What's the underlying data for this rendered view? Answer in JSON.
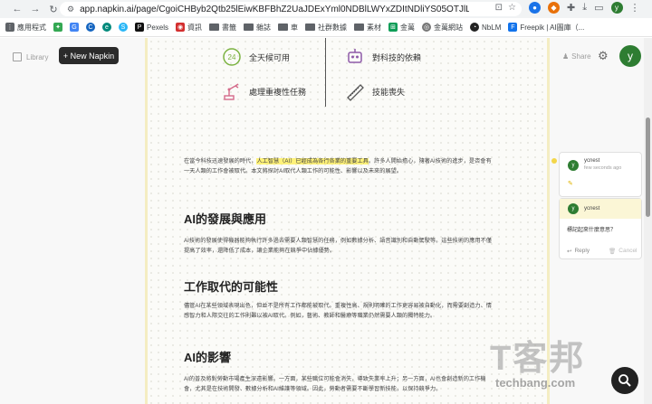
{
  "browser": {
    "url": "app.napkin.ai/page/CgoiCHByb2Qtb25lEiwKBFBhZ2UaJDExYml0NDBlLWYxZDItNDliYS05OTJlLTE0NzcxYzViM..."
  },
  "bookmarks": [
    {
      "label": "應用程式",
      "icon": "apps-icon"
    },
    {
      "label": "",
      "icon": "puzzle-icon"
    },
    {
      "label": "",
      "icon": "g-icon"
    },
    {
      "label": "",
      "icon": "c-icon"
    },
    {
      "label": "",
      "icon": "e-icon"
    },
    {
      "label": "",
      "icon": "s-icon"
    },
    {
      "label": "Pexels",
      "icon": "pexels-icon"
    },
    {
      "label": "資訊",
      "icon": "info-icon"
    },
    {
      "label": "書籤",
      "icon": "folder-icon"
    },
    {
      "label": "雜誌",
      "icon": "folder-icon"
    },
    {
      "label": "車",
      "icon": "folder-icon"
    },
    {
      "label": "社群數據",
      "icon": "folder-icon"
    },
    {
      "label": "素材",
      "icon": "folder-icon"
    },
    {
      "label": "金萬",
      "icon": "finance-icon"
    },
    {
      "label": "金萬網站",
      "icon": "finance-icon"
    },
    {
      "label": "NbLM",
      "icon": "nblm-icon"
    },
    {
      "label": "Freepik | AI圖庫（...",
      "icon": "freepik-icon"
    }
  ],
  "sidebar": {
    "library_label": "Library",
    "new_label": "+ New Napkin"
  },
  "header": {
    "share_label": "Share",
    "avatar_letter": "y"
  },
  "diagram": {
    "items": [
      {
        "label": "全天候可用",
        "icon": "clock-24-icon"
      },
      {
        "label": "對科技的依賴",
        "icon": "robot-icon"
      },
      {
        "label": "處理重複性任務",
        "icon": "robot-arm-icon"
      },
      {
        "label": "技能喪失",
        "icon": "saw-icon"
      }
    ]
  },
  "document": {
    "intro_before": "在當今科技迅速發展的時代，",
    "intro_highlight": "人工智慧（AI）已經成為各行各業的重要工具",
    "intro_after": "。許多人開始擔心，隨著AI技術的進步，是否會有一天人類的工作會被取代。本文將探討AI取代人類工作的可能性、影響以及未來的展望。",
    "sections": [
      {
        "heading": "AI的發展與應用",
        "text": "AI技術的發展使得機器能夠執行許多過去需要人類智慧的任務，例如數據分析、語音識別和自動駕駛等。這些技術的應用不僅提高了效率，還降低了成本，讓企業能夠在競爭中佔據優勢。"
      },
      {
        "heading": "工作取代的可能性",
        "text": "儘管AI在某些領域表現出色，但並不是所有工作都能被取代。重複性高、規則明確的工作更容易被自動化，而需要創造力、情感智力和人際交往的工作則難以被AI取代。例如，藝術、教師和醫療等職業仍然需要人類的獨特能力。"
      },
      {
        "heading": "AI的影響",
        "text": "AI的普及將對勞動市場產生深遠影響。一方面，某些職位可能會消失，導致失業率上升；另一方面，AI也會創造新的工作機會，尤其是在技術開發、數據分析和AI維護等領域。因此，勞動者需要不斷學習新技能，以保持競爭力。"
      }
    ]
  },
  "comments": {
    "first": {
      "author": "ycnest",
      "time": "few seconds ago",
      "avatar": "y"
    },
    "second": {
      "author": "ycnest",
      "avatar": "y",
      "text": "標記起來什麼意思？",
      "reply_label": "Reply",
      "cancel_label": "Cancel"
    }
  },
  "watermark": {
    "text": "techbang.com"
  },
  "colors": {
    "accent_yellow": "#f3d64a",
    "highlight": "#fff27a",
    "avatar_green": "#2e7d32",
    "new_button": "#2b2b2b"
  }
}
